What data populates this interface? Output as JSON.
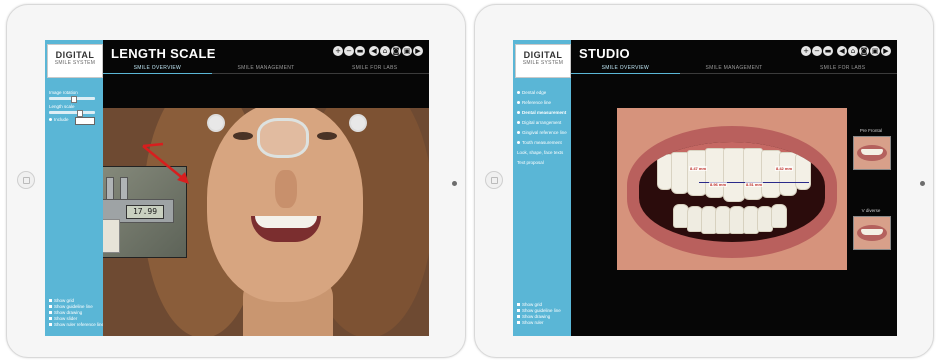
{
  "left_app": {
    "logo": {
      "line1": "DIGITAL",
      "line2": "SMILE SYSTEM"
    },
    "title": "LENGTH SCALE",
    "toolbar_icons": [
      "zoom-in-icon",
      "zoom-out-icon",
      "trash-icon",
      "back-icon",
      "home-icon",
      "camera-icon",
      "save-icon",
      "forward-icon"
    ],
    "tabs": [
      "SMILE OVERVIEW",
      "SMILE MANAGEMENT",
      "SMILE FOR LABS"
    ],
    "sidebar": {
      "items": [
        "Image rotation",
        "Length scale",
        "Include"
      ],
      "bottom_items": [
        "Show grid",
        "Show guideline line",
        "Show drawing",
        "Show slider",
        "Show ruler reference lines"
      ]
    },
    "caliper_reading": "17.99"
  },
  "right_app": {
    "logo": {
      "line1": "DIGITAL",
      "line2": "SMILE SYSTEM"
    },
    "title": "STUDIO",
    "toolbar_icons": [
      "zoom-in-icon",
      "zoom-out-icon",
      "trash-icon",
      "back-icon",
      "home-icon",
      "camera-icon",
      "save-icon",
      "forward-icon"
    ],
    "tabs": [
      "SMILE OVERVIEW",
      "SMILE MANAGEMENT",
      "SMILE FOR LABS"
    ],
    "sidebar": {
      "items": [
        "Dental edge",
        "Reference line",
        "Dental measurement",
        "Digital arrangement",
        "Gingival reference line",
        "Tooth measurement",
        "Look, shape, face texts",
        "Text proposal"
      ],
      "bottom_items": [
        "Show grid",
        "Show guideline line",
        "Show drawing",
        "Show ruler"
      ]
    },
    "measurements": [
      "8.47 mm",
      "8.96 mm",
      "8.51 mm",
      "8.42 mm"
    ],
    "thumbnails": [
      {
        "label": "Pre Frontal"
      },
      {
        "label": "V diverse"
      }
    ]
  }
}
